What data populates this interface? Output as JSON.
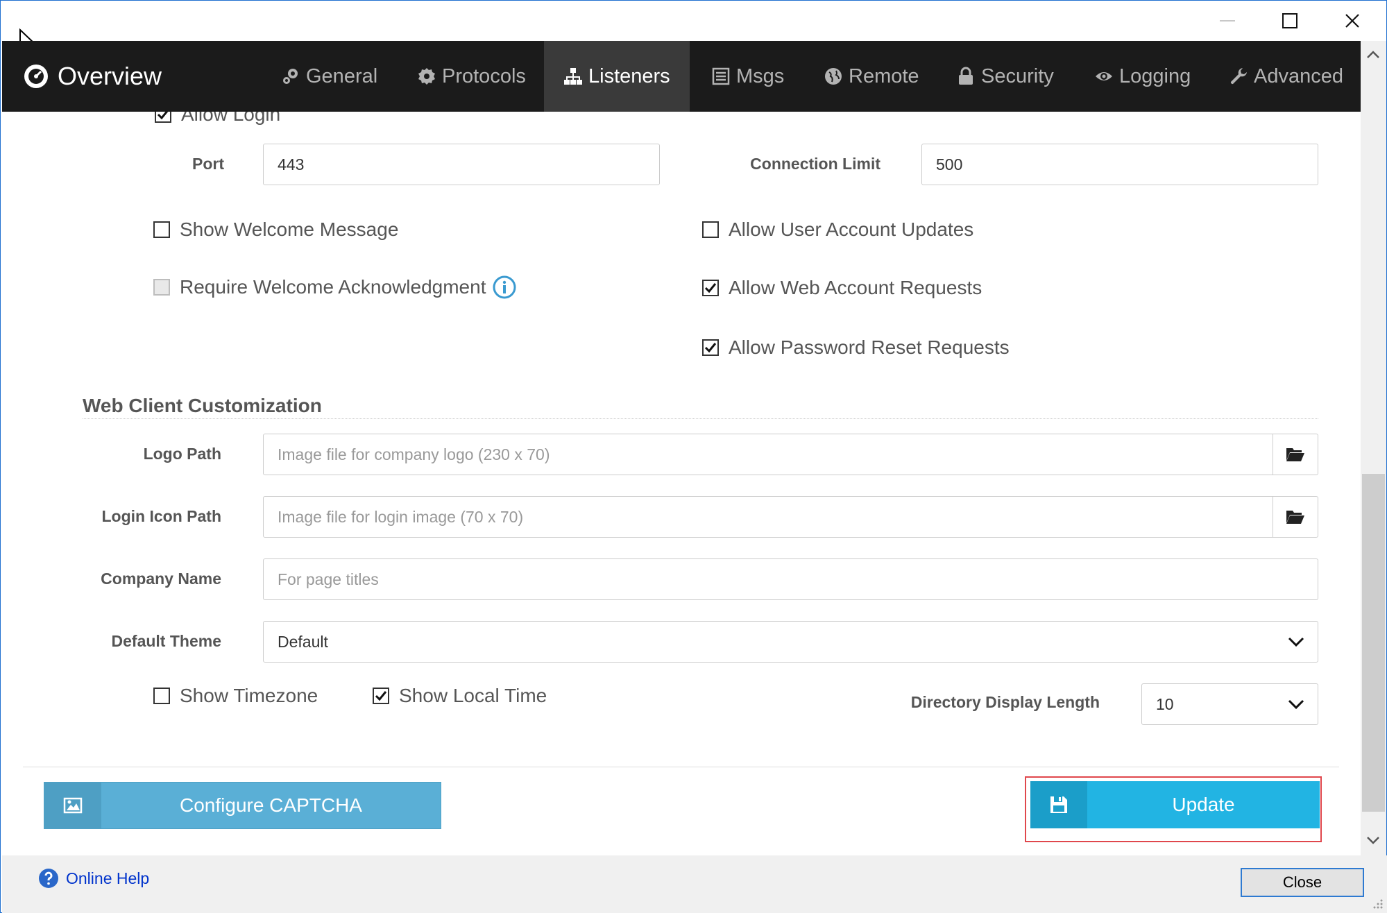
{
  "window": {
    "controls": [
      "minimize",
      "maximize",
      "close"
    ]
  },
  "navbar": {
    "brand": "Overview",
    "tabs": [
      {
        "label": "General",
        "icon": "gears-icon"
      },
      {
        "label": "Protocols",
        "icon": "gear-icon"
      },
      {
        "label": "Listeners",
        "icon": "sitemap-icon",
        "active": true
      },
      {
        "label": "Msgs",
        "icon": "list-icon"
      },
      {
        "label": "Remote",
        "icon": "globe-icon"
      },
      {
        "label": "Security",
        "icon": "lock-icon"
      },
      {
        "label": "Logging",
        "icon": "eye-icon"
      },
      {
        "label": "Advanced",
        "icon": "wrench-icon"
      }
    ]
  },
  "form": {
    "allow_login": {
      "label": "Allow Login",
      "checked": true
    },
    "port": {
      "label": "Port",
      "value": "443"
    },
    "connection_limit": {
      "label": "Connection Limit",
      "value": "500"
    },
    "show_welcome": {
      "label": "Show Welcome Message",
      "checked": false
    },
    "require_ack": {
      "label": "Require Welcome Acknowledgment",
      "checked": false,
      "disabled": true
    },
    "allow_user_updates": {
      "label": "Allow User Account Updates",
      "checked": false
    },
    "allow_web_requests": {
      "label": "Allow Web Account Requests",
      "checked": true
    },
    "allow_password_reset": {
      "label": "Allow Password Reset Requests",
      "checked": true
    }
  },
  "web_client": {
    "section_title": "Web Client Customization",
    "logo_path": {
      "label": "Logo Path",
      "placeholder": "Image file for company logo (230 x 70)"
    },
    "login_icon_path": {
      "label": "Login Icon Path",
      "placeholder": "Image file for login image (70 x 70)"
    },
    "company_name": {
      "label": "Company Name",
      "placeholder": "For page titles"
    },
    "default_theme": {
      "label": "Default Theme",
      "value": "Default"
    },
    "show_timezone": {
      "label": "Show Timezone",
      "checked": false
    },
    "show_local_time": {
      "label": "Show Local Time",
      "checked": true
    },
    "directory_display_length": {
      "label": "Directory Display Length",
      "value": "10"
    }
  },
  "actions": {
    "configure_captcha": "Configure CAPTCHA",
    "update": "Update"
  },
  "footer": {
    "online_help": "Online Help",
    "close": "Close"
  },
  "colors": {
    "navbar_bg": "#1b1b1b",
    "active_tab_bg": "#3a3a3a",
    "captcha_button": "#5aafd6",
    "update_button": "#22b4e3",
    "highlight": "#e0474c",
    "link": "#0033cc"
  }
}
